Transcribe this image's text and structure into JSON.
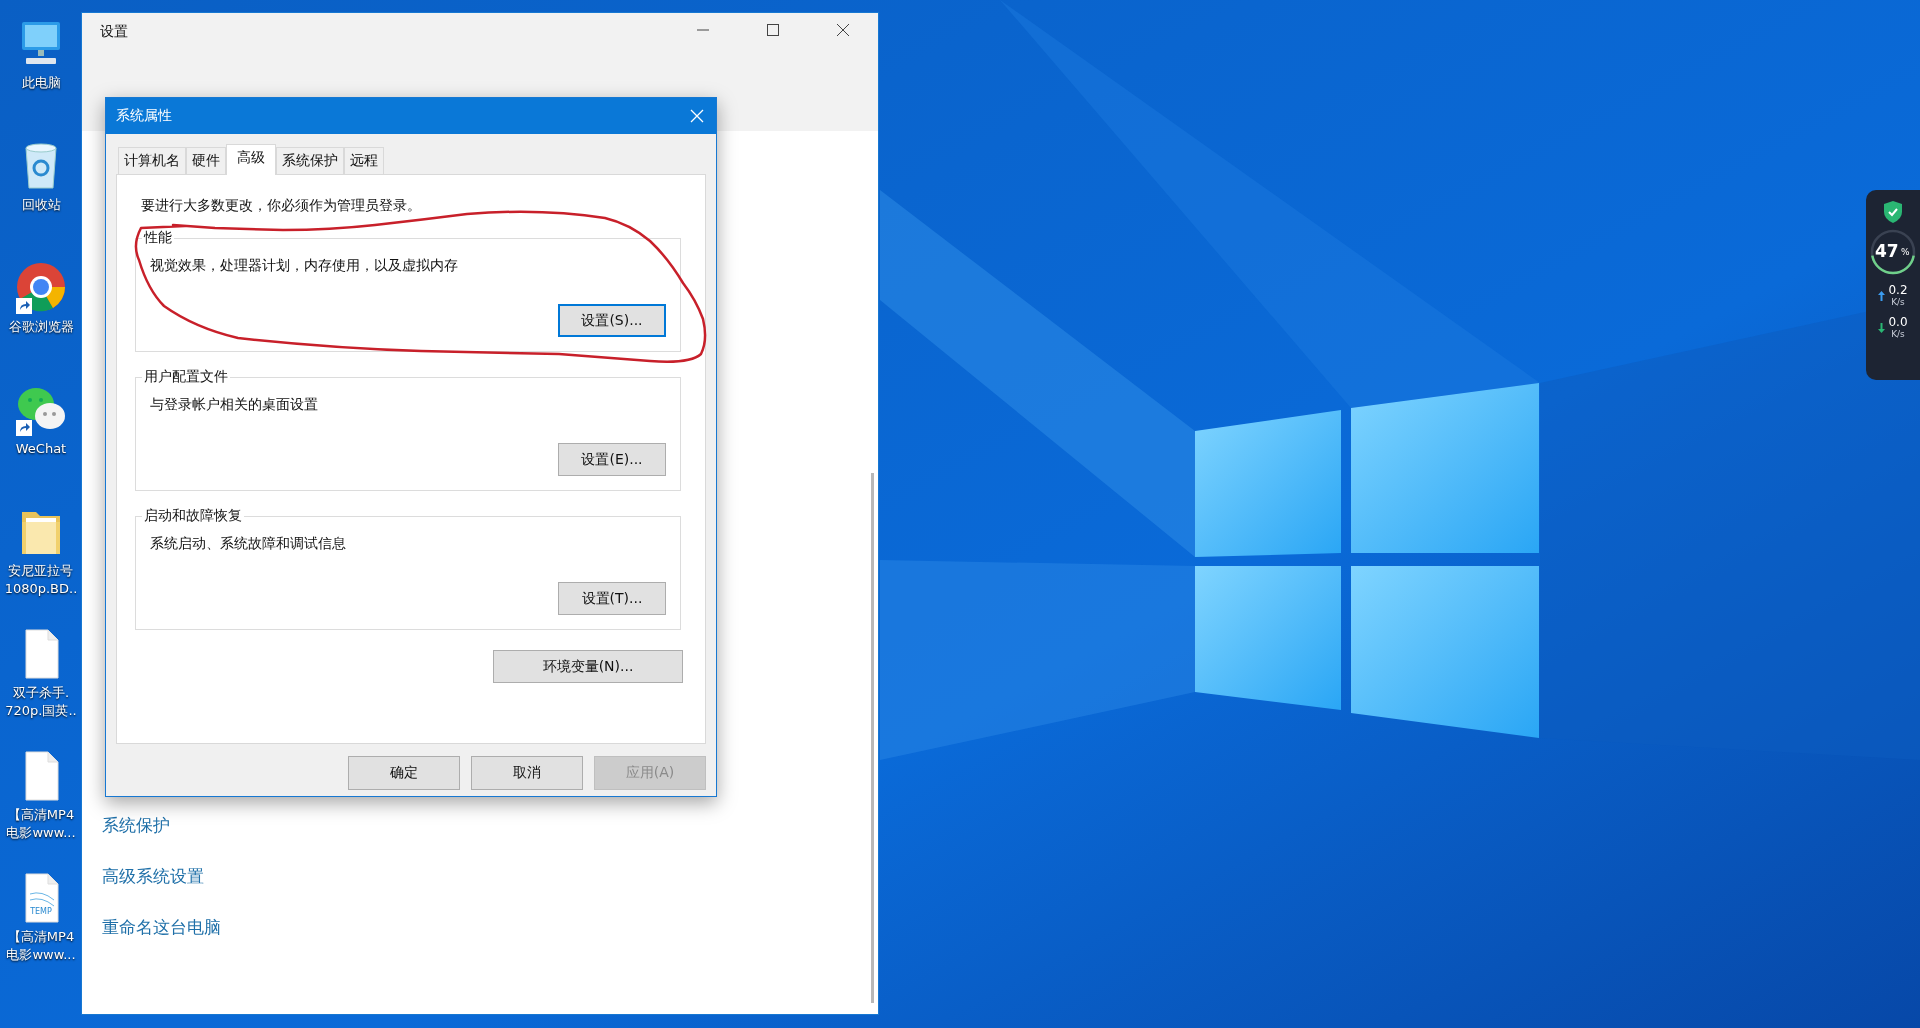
{
  "desktop_icons": [
    {
      "kind": "computer",
      "lines": [
        "此电脑"
      ],
      "shortcut": false
    },
    {
      "kind": "recycle",
      "lines": [
        "回收站"
      ],
      "shortcut": false
    },
    {
      "kind": "browser",
      "lines": [
        "谷歌浏览器"
      ],
      "shortcut": true
    },
    {
      "kind": "chat",
      "lines": [
        "WeChat"
      ],
      "shortcut": true
    },
    {
      "kind": "folder",
      "lines": [
        "安尼亚拉号",
        "1080p.BD.."
      ],
      "shortcut": false
    },
    {
      "kind": "file",
      "lines": [
        "双子杀手.",
        "720p.国英.."
      ],
      "shortcut": false
    },
    {
      "kind": "file",
      "lines": [
        "【高清MP4",
        "电影www..."
      ],
      "shortcut": false
    },
    {
      "kind": "tempfile",
      "badge": "TEMP",
      "lines": [
        "【高清MP4",
        "电影www..."
      ],
      "shortcut": false
    }
  ],
  "settings_window": {
    "title": "设置",
    "links": [
      "系统保护",
      "高级系统设置",
      "重命名这台电脑"
    ]
  },
  "dialog": {
    "title": "系统属性",
    "tabs": [
      {
        "label": "计算机名",
        "selected": false
      },
      {
        "label": "硬件",
        "selected": false
      },
      {
        "label": "高级",
        "selected": true
      },
      {
        "label": "系统保护",
        "selected": false
      },
      {
        "label": "远程",
        "selected": false
      }
    ],
    "notice": "要进行大多数更改，你必须作为管理员登录。",
    "groups": [
      {
        "title": "性能",
        "description": "视觉效果，处理器计划，内存使用，以及虚拟内存",
        "button": "设置(S)...",
        "focused": true
      },
      {
        "title": "用户配置文件",
        "description": "与登录帐户相关的桌面设置",
        "button": "设置(E)...",
        "focused": false
      },
      {
        "title": "启动和故障恢复",
        "description": "系统启动、系统故障和调试信息",
        "button": "设置(T)...",
        "focused": false
      }
    ],
    "env_button": "环境变量(N)...",
    "buttons": [
      {
        "label": "确定",
        "disabled": false
      },
      {
        "label": "取消",
        "disabled": false
      },
      {
        "label": "应用(A)",
        "disabled": true
      }
    ]
  },
  "widget": {
    "percent": "47",
    "unit": "%",
    "upload": "0.2",
    "upload_unit": "K/s",
    "download": "0.0",
    "download_unit": "K/s"
  }
}
